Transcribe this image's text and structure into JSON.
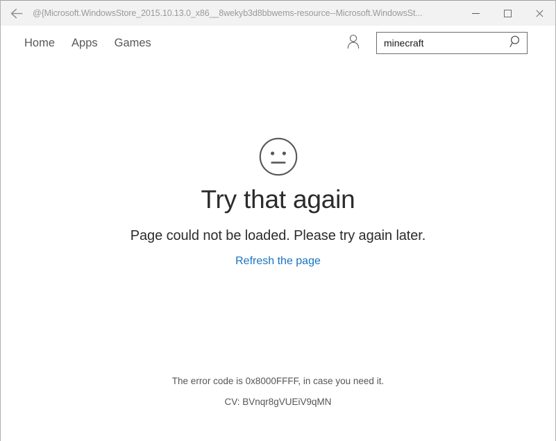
{
  "window": {
    "title": "@{Microsoft.WindowsStore_2015.10.13.0_x86__8wekyb3d8bbwems-resource--Microsoft.WindowsSt...",
    "back_label": "Back",
    "minimize_label": "Minimize",
    "maximize_label": "Maximize",
    "close_label": "Close",
    "titlebar_bg": "#f2f2f2",
    "border_color": "#b0b0b0"
  },
  "nav": {
    "links": [
      {
        "label": "Home"
      },
      {
        "label": "Apps"
      },
      {
        "label": "Games"
      }
    ],
    "account_icon": "person-icon"
  },
  "search": {
    "value": "minecraft",
    "placeholder": "Search",
    "submit_icon": "magnifier-icon"
  },
  "error": {
    "face_icon": "neutral-face-icon",
    "title": "Try that again",
    "subtitle": "Page could not be loaded. Please try again later.",
    "refresh_link": "Refresh the page",
    "link_color": "#1673c1",
    "error_code_line": "The error code is 0x8000FFFF, in case you need it.",
    "cv_line": "CV: BVnqr8gVUEiV9qMN"
  }
}
